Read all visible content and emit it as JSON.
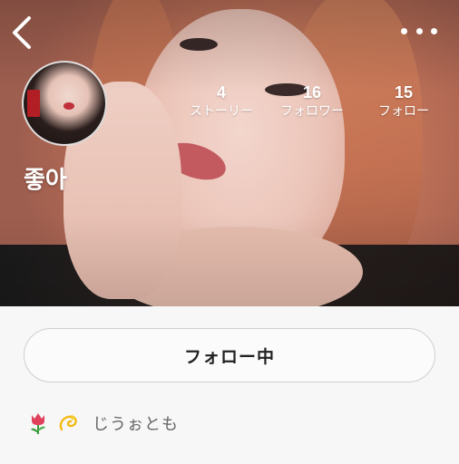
{
  "profile": {
    "username": "좋아",
    "stats": [
      {
        "value": "4",
        "label": "ストーリー"
      },
      {
        "value": "16",
        "label": "フォロワー"
      },
      {
        "value": "15",
        "label": "フォロー"
      }
    ],
    "follow_button_label": "フォロー中",
    "bio": {
      "emojis": [
        "tulip-icon",
        "dizzy-icon"
      ],
      "text": "じうぉとも"
    }
  },
  "icons": {
    "back": "chevron-left-icon",
    "more": "more-horizontal-icon"
  },
  "colors": {
    "background": "#f7f7f7",
    "button_border": "#cfcfcf",
    "bio_text": "#666666"
  }
}
